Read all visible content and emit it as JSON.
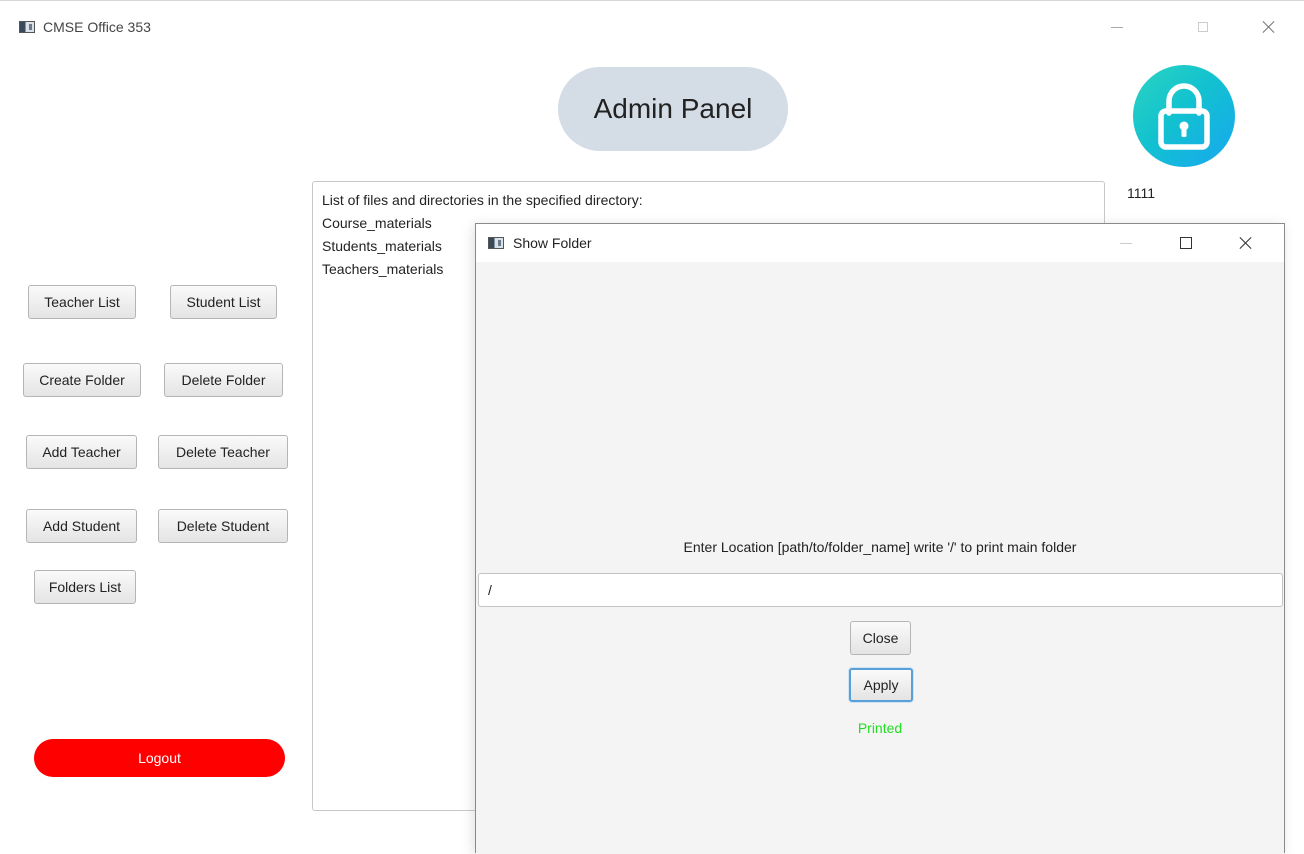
{
  "main_window": {
    "title": "CMSE Office 353",
    "header": "Admin Panel",
    "user_code": "1111",
    "lock_icon": "lock-icon",
    "colors": {
      "header_bg": "#d4dce6",
      "lock_gradient_start": "#2dd4c0",
      "lock_gradient_end": "#19a7f0",
      "logout_bg": "#ff0000"
    }
  },
  "sidebar": {
    "teacher_list": "Teacher List",
    "student_list": "Student List",
    "create_folder": "Create Folder",
    "delete_folder": "Delete Folder",
    "add_teacher": "Add Teacher",
    "delete_teacher": "Delete Teacher",
    "add_student": "Add Student",
    "delete_student": "Delete Student",
    "folders_list": "Folders List",
    "logout": "Logout"
  },
  "output": {
    "lines": [
      "List of files and directories in the specified directory:",
      "Course_materials",
      "Students_materials",
      "Teachers_materials"
    ]
  },
  "dialog": {
    "title": "Show Folder",
    "prompt": "Enter Location [path/to/folder_name] write '/' to print main folder",
    "location_value": "/",
    "close_label": "Close",
    "apply_label": "Apply",
    "status": "Printed",
    "status_color": "#22dd22"
  }
}
